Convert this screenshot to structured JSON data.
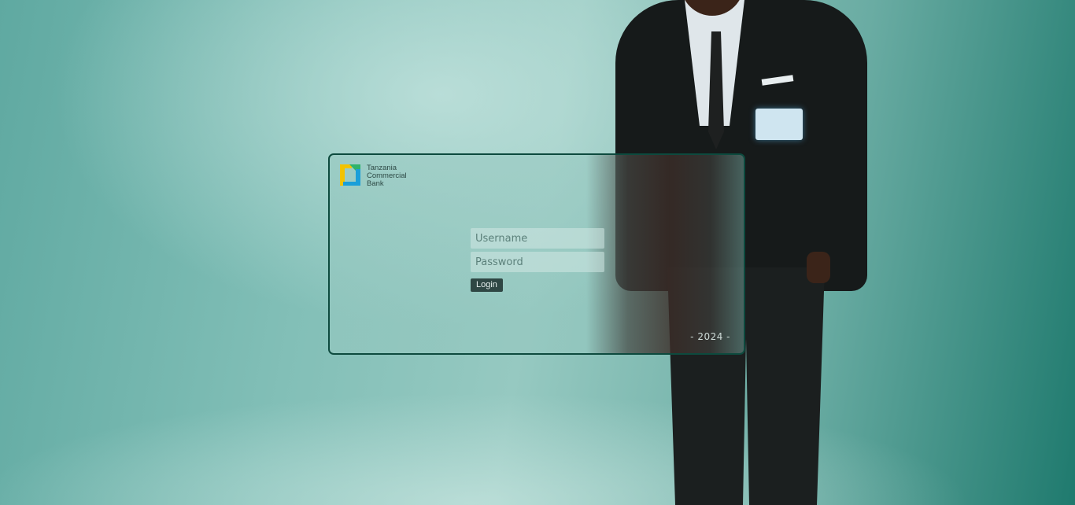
{
  "brand": {
    "name_lines": [
      "Tanzania",
      "Commercial",
      "Bank"
    ],
    "colors": {
      "yellow": "#f2c300",
      "green": "#2fb36a",
      "blue": "#1a9fd9"
    },
    "logo_icon": "tcb-logo-mark"
  },
  "form": {
    "username_placeholder": "Username",
    "username_value": "",
    "password_placeholder": "Password",
    "password_value": "",
    "login_label": "Login"
  },
  "footer": {
    "year_text": "- 2024 -"
  },
  "theme": {
    "card_border": "#0d4a3e",
    "button_bg": "#2f4744"
  }
}
